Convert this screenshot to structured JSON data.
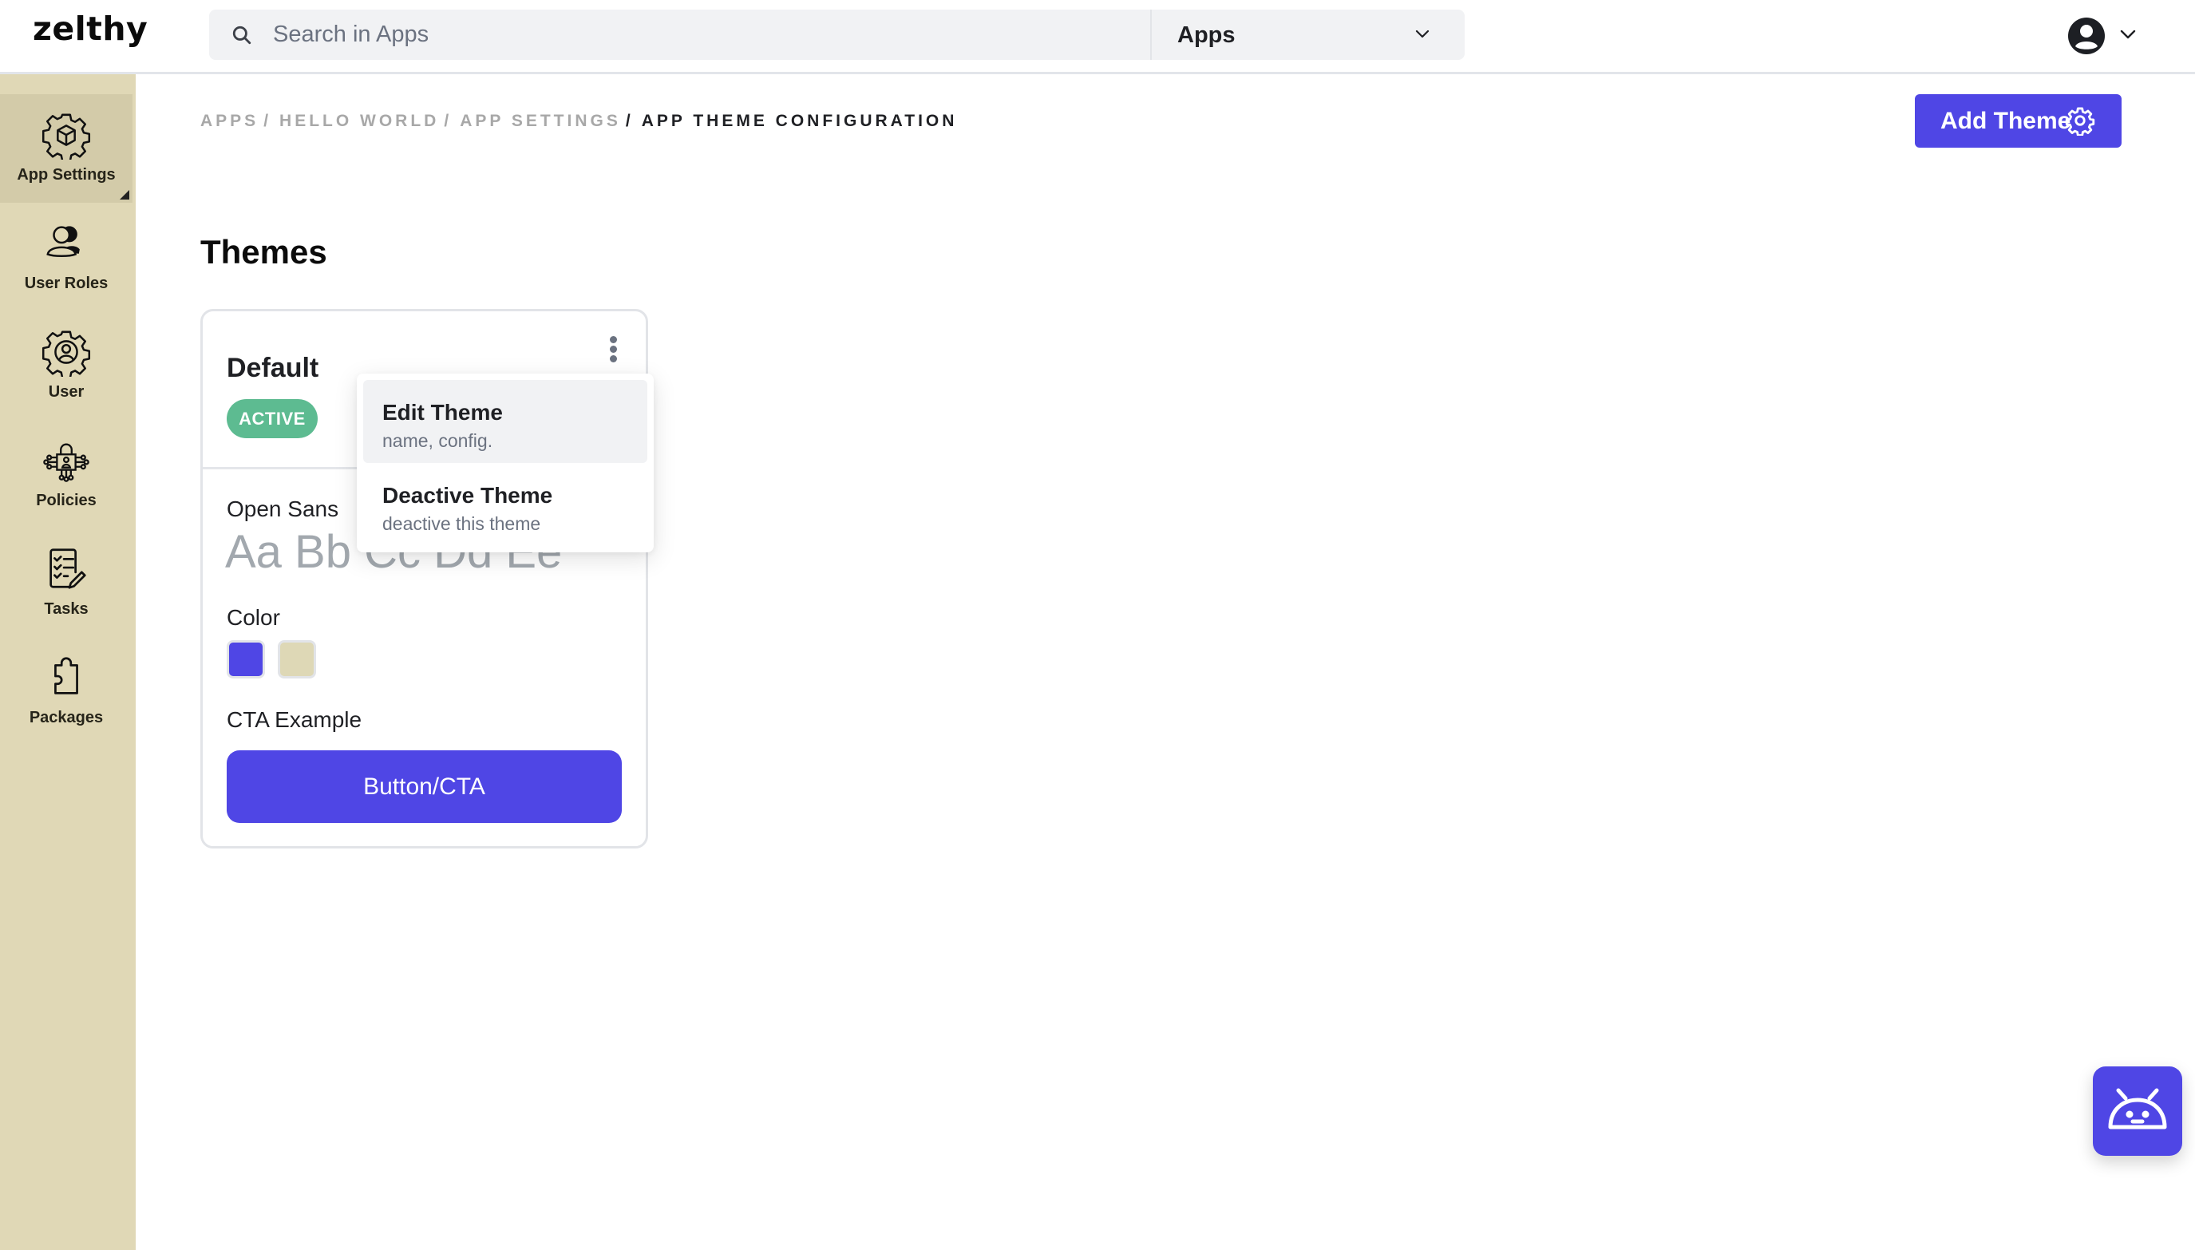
{
  "header": {
    "logo": "zelthy",
    "search": {
      "placeholder": "Search in Apps",
      "value": ""
    },
    "scope": {
      "selected": "Apps"
    }
  },
  "sidebar": {
    "items": [
      {
        "label": "App Settings",
        "icon": "app-settings-icon",
        "active": true
      },
      {
        "label": "User Roles",
        "icon": "user-roles-icon",
        "active": false
      },
      {
        "label": "User",
        "icon": "user-gear-icon",
        "active": false
      },
      {
        "label": "Policies",
        "icon": "policies-icon",
        "active": false
      },
      {
        "label": "Tasks",
        "icon": "tasks-icon",
        "active": false
      },
      {
        "label": "Packages",
        "icon": "packages-icon",
        "active": false
      }
    ]
  },
  "breadcrumb": {
    "items": [
      "APPS",
      "HELLO WORLD",
      "APP SETTINGS"
    ],
    "current": "APP THEME CONFIGURATION",
    "separator": "/"
  },
  "toolbar": {
    "add_theme_label": "Add Theme"
  },
  "main": {
    "title": "Themes",
    "themes": [
      {
        "name": "Default",
        "status": "ACTIVE",
        "font_name": "Open Sans",
        "font_sample": "Aa Bb Cc Dd Ee",
        "color_label": "Color",
        "colors": [
          "#4f46e5",
          "#ded8b6"
        ],
        "cta_label": "CTA Example",
        "cta_button": "Button/CTA"
      }
    ]
  },
  "theme_menu": {
    "items": [
      {
        "title": "Edit Theme",
        "subtitle": "name, config."
      },
      {
        "title": "Deactive Theme",
        "subtitle": "deactive this theme"
      }
    ]
  },
  "colors": {
    "accent": "#4f46e5",
    "sidebar_bg": "#e0d8b6",
    "sidebar_active": "#d3cba9",
    "active_badge": "#5dbb91"
  }
}
